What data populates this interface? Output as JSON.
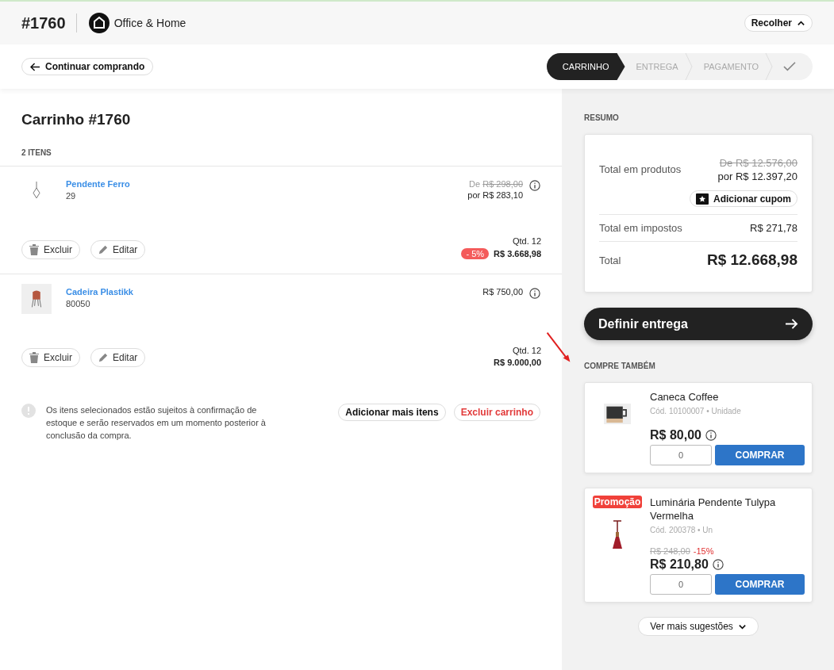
{
  "header": {
    "order": "#1760",
    "store": "Office & Home",
    "collapse_button": "Recolher"
  },
  "back_button": "Continuar comprando",
  "steps": [
    {
      "label": "CARRINHO",
      "selected": true
    },
    {
      "label": "ENTREGA",
      "selected": false
    },
    {
      "label": "PAGAMENTO",
      "selected": false
    }
  ],
  "cart": {
    "title": "Carrinho #1760",
    "count": "2 ITENS",
    "items": [
      {
        "name": "Pendente Ferro",
        "code": "29",
        "old_price_prefix": "De",
        "old_price": "R$ 298,00",
        "price": "por R$ 283,10",
        "qty": "Qtd. 12",
        "discount": "- 5%",
        "total": "R$ 3.668,98",
        "delete": "Excluir",
        "edit": "Editar",
        "kind": "lamp"
      },
      {
        "name": "Cadeira Plastikk",
        "code": "80050",
        "price": "R$ 750,00",
        "qty": "Qtd. 12",
        "total": "R$ 9.000,00",
        "delete": "Excluir",
        "edit": "Editar",
        "kind": "chair"
      }
    ],
    "notice": "Os itens selecionados estão sujeitos à confirmação de estoque e serão reservados em um momento posterior à conclusão da compra.",
    "add_button": "Adicionar mais itens",
    "clear_button": "Excluir carrinho"
  },
  "summary": {
    "title": "RESUMO",
    "products_label": "Total em produtos",
    "products_old": "De R$ 12.576,00",
    "products_price": "por R$ 12.397,20",
    "coupon_button": "Adicionar cupom",
    "taxes_label": "Total em impostos",
    "taxes": "R$ 271,78",
    "total_label": "Total",
    "total": "R$ 12.668,98",
    "next_button": "Definir entrega"
  },
  "suggestions": {
    "title": "COMPRE TAMBÉM",
    "items": [
      {
        "name": "Caneca Coffee",
        "code": "Cód. 10100007 • Unidade",
        "price": "R$ 80,00",
        "quantity": "0",
        "buy": "COMPRAR",
        "kind": "mug"
      },
      {
        "badge": "Promoção",
        "name": "Luminária Pendente Tulypa Vermelha",
        "code": "Cód. 200378 • Un",
        "old_price": "R$ 248,00",
        "discount": "-15%",
        "price": "R$ 210,80",
        "quantity": "0",
        "buy": "COMPRAR",
        "kind": "pendant"
      }
    ],
    "more_button": "Ver mais sugestões"
  }
}
